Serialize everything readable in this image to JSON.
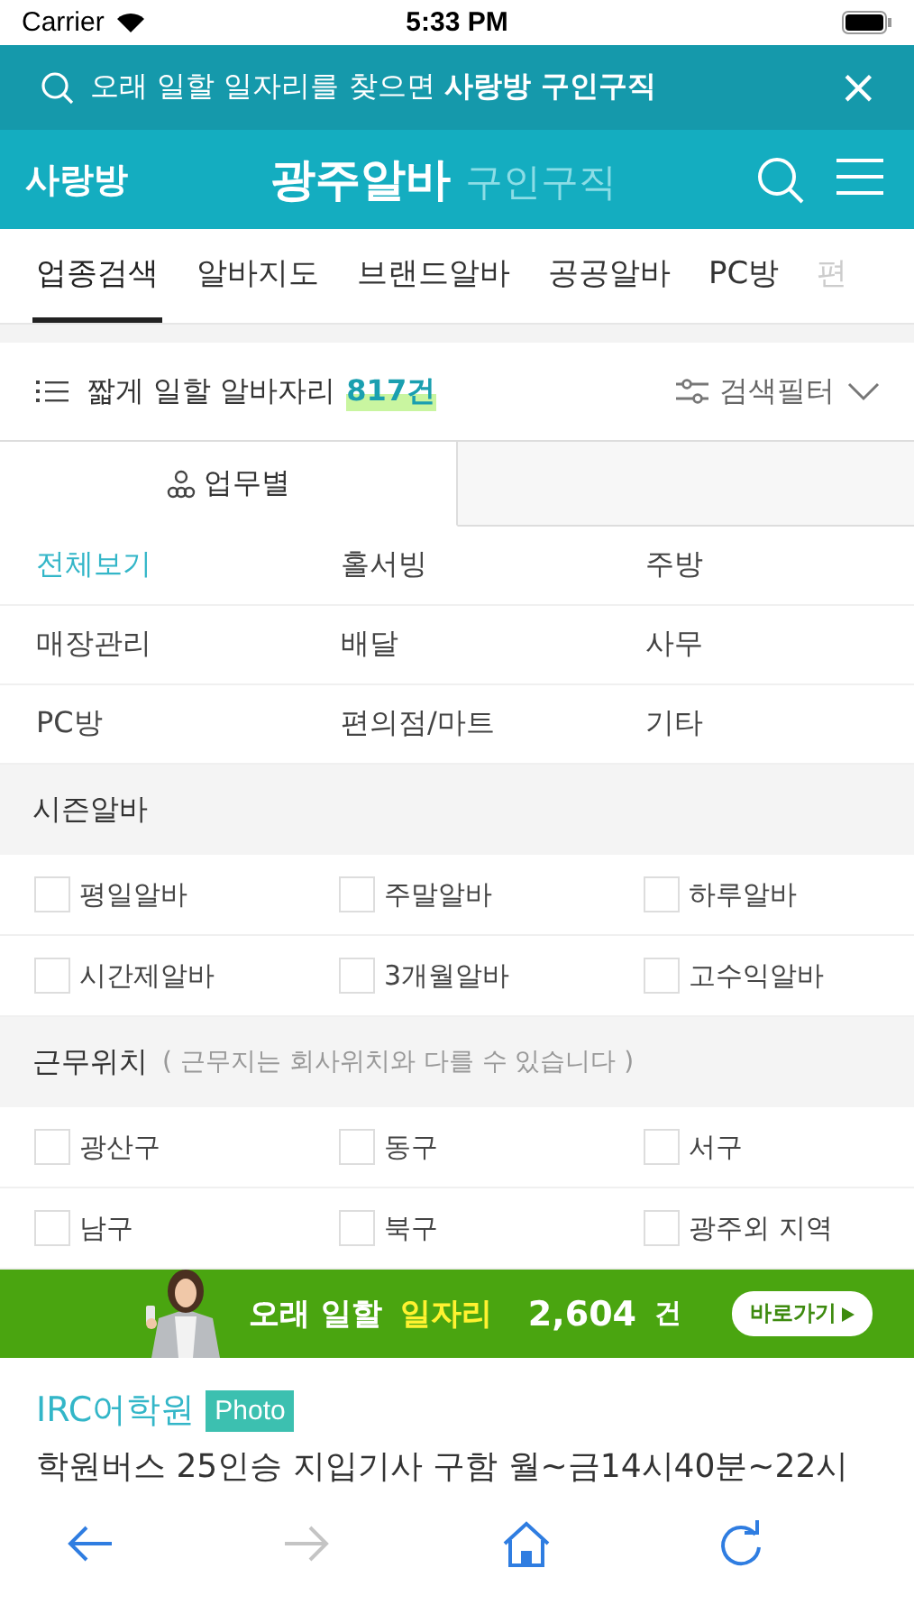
{
  "status_bar": {
    "carrier": "Carrier",
    "time": "5:33 PM"
  },
  "promo_bar": {
    "text": "오래 일할 일자리를 찾으면 **사랑방 구인구직**",
    "close": "×"
  },
  "header": {
    "logo": "사랑방",
    "title": "광주알바",
    "subtitle": "구인구직"
  },
  "nav_tabs": [
    {
      "label": "업종검색",
      "selected": true
    },
    {
      "label": "알바지도",
      "selected": false
    },
    {
      "label": "브랜드알바",
      "selected": false
    },
    {
      "label": "공공알바",
      "selected": false
    },
    {
      "label": "PC방",
      "selected": false
    },
    {
      "label": "편",
      "selected": false
    }
  ],
  "summary": {
    "text": "짧게 일할 알바자리",
    "count": "817건",
    "filter": "검색필터"
  },
  "view_tabs": [
    {
      "label": "업무별",
      "selected": true
    }
  ],
  "categories": [
    {
      "label": "전체보기",
      "selected": true
    },
    {
      "label": "홀서빙",
      "selected": false
    },
    {
      "label": "주방",
      "selected": false
    },
    {
      "label": "매장관리",
      "selected": false
    },
    {
      "label": "배달",
      "selected": false
    },
    {
      "label": "사무",
      "selected": false
    },
    {
      "label": "PC방",
      "selected": false
    },
    {
      "label": "편의점/마트",
      "selected": false
    },
    {
      "label": "기타",
      "selected": false
    }
  ],
  "sections": [
    {
      "title": "시즌알바",
      "options": [
        {
          "label": "평일알바",
          "checked": false
        },
        {
          "label": "주말알바",
          "checked": false
        },
        {
          "label": "하루알바",
          "checked": false
        },
        {
          "label": "시간제알바",
          "checked": false
        },
        {
          "label": "3개월알바",
          "checked": false
        },
        {
          "label": "고수익알바",
          "checked": false
        }
      ]
    },
    {
      "title": "근무위치",
      "note": "( 근무지는 회사위치와 다를 수 있습니다 )",
      "options": [
        {
          "label": "광산구",
          "checked": false
        },
        {
          "label": "동구",
          "checked": false
        },
        {
          "label": "서구",
          "checked": false
        },
        {
          "label": "남구",
          "checked": false
        },
        {
          "label": "북구",
          "checked": false
        },
        {
          "label": "광주외 지역",
          "checked": false
        }
      ]
    }
  ],
  "ad_banner": {
    "text": "오래 일할",
    "highlight": "일자리",
    "count": "2,604",
    "unit": "건",
    "button": "바로가기"
  },
  "listing": {
    "company": "IRC어학원",
    "badge": "Photo",
    "title": "학원버스 25인승 지입기사 구함 월~금14시40분~22시"
  },
  "bottom_nav": [
    {
      "kind": "back",
      "disabled": false
    },
    {
      "kind": "forward",
      "disabled": true
    },
    {
      "kind": "home",
      "disabled": false
    },
    {
      "kind": "reload",
      "disabled": false
    }
  ]
}
